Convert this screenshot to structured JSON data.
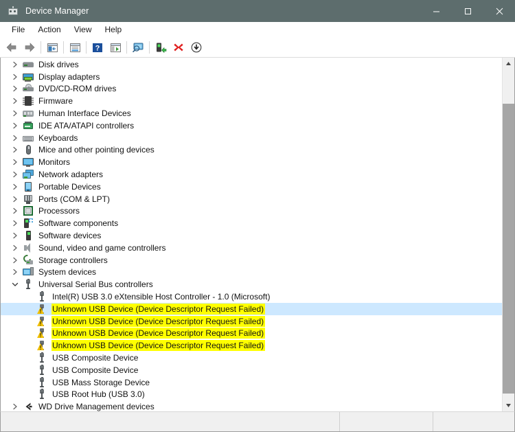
{
  "window": {
    "title": "Device Manager",
    "icon": "device-manager-icon",
    "controls": {
      "minimize": "minimize-icon",
      "maximize": "maximize-icon",
      "close": "close-icon"
    },
    "titlebar_color": "#5d6d6d"
  },
  "menu": {
    "items": [
      {
        "label": "File"
      },
      {
        "label": "Action"
      },
      {
        "label": "View"
      },
      {
        "label": "Help"
      }
    ]
  },
  "toolbar": {
    "buttons": [
      {
        "name": "back-icon",
        "tip": "Back"
      },
      {
        "name": "forward-icon",
        "tip": "Forward"
      },
      {
        "name": "separator-1",
        "tip": ""
      },
      {
        "name": "show-hide-console-tree-icon",
        "tip": "Show/Hide Console Tree"
      },
      {
        "name": "separator-2",
        "tip": ""
      },
      {
        "name": "properties-icon",
        "tip": "Properties"
      },
      {
        "name": "separator-3",
        "tip": ""
      },
      {
        "name": "help-icon",
        "tip": "Help"
      },
      {
        "name": "update-driver-icon",
        "tip": "Update driver"
      },
      {
        "name": "separator-4",
        "tip": ""
      },
      {
        "name": "scan-for-hardware-changes-icon",
        "tip": "Scan for hardware changes"
      },
      {
        "name": "separator-5",
        "tip": ""
      },
      {
        "name": "enable-device-icon",
        "tip": "Enable device"
      },
      {
        "name": "uninstall-device-icon",
        "tip": "Uninstall device"
      },
      {
        "name": "disable-device-icon",
        "tip": "Disable device"
      }
    ]
  },
  "tree": {
    "rows": [
      {
        "label": "Disk drives",
        "level": 0,
        "expander": "collapsed",
        "icon": "disk-drive-icon",
        "highlight": false,
        "selected": false
      },
      {
        "label": "Display adapters",
        "level": 0,
        "expander": "collapsed",
        "icon": "display-adapter-icon",
        "highlight": false,
        "selected": false
      },
      {
        "label": "DVD/CD-ROM drives",
        "level": 0,
        "expander": "collapsed",
        "icon": "dvd-cd-rom-icon",
        "highlight": false,
        "selected": false
      },
      {
        "label": "Firmware",
        "level": 0,
        "expander": "collapsed",
        "icon": "firmware-chip-icon",
        "highlight": false,
        "selected": false
      },
      {
        "label": "Human Interface Devices",
        "level": 0,
        "expander": "collapsed",
        "icon": "human-interface-device-icon",
        "highlight": false,
        "selected": false
      },
      {
        "label": "IDE ATA/ATAPI controllers",
        "level": 0,
        "expander": "collapsed",
        "icon": "ide-controller-icon",
        "highlight": false,
        "selected": false
      },
      {
        "label": "Keyboards",
        "level": 0,
        "expander": "collapsed",
        "icon": "keyboard-icon",
        "highlight": false,
        "selected": false
      },
      {
        "label": "Mice and other pointing devices",
        "level": 0,
        "expander": "collapsed",
        "icon": "mouse-icon",
        "highlight": false,
        "selected": false
      },
      {
        "label": "Monitors",
        "level": 0,
        "expander": "collapsed",
        "icon": "monitor-icon",
        "highlight": false,
        "selected": false
      },
      {
        "label": "Network adapters",
        "level": 0,
        "expander": "collapsed",
        "icon": "network-adapter-icon",
        "highlight": false,
        "selected": false
      },
      {
        "label": "Portable Devices",
        "level": 0,
        "expander": "collapsed",
        "icon": "portable-device-icon",
        "highlight": false,
        "selected": false
      },
      {
        "label": "Ports (COM & LPT)",
        "level": 0,
        "expander": "collapsed",
        "icon": "port-icon",
        "highlight": false,
        "selected": false
      },
      {
        "label": "Processors",
        "level": 0,
        "expander": "collapsed",
        "icon": "processor-icon",
        "highlight": false,
        "selected": false
      },
      {
        "label": "Software components",
        "level": 0,
        "expander": "collapsed",
        "icon": "software-component-icon",
        "highlight": false,
        "selected": false
      },
      {
        "label": "Software devices",
        "level": 0,
        "expander": "collapsed",
        "icon": "software-device-icon",
        "highlight": false,
        "selected": false
      },
      {
        "label": "Sound, video and game controllers",
        "level": 0,
        "expander": "collapsed",
        "icon": "sound-controller-icon",
        "highlight": false,
        "selected": false
      },
      {
        "label": "Storage controllers",
        "level": 0,
        "expander": "collapsed",
        "icon": "storage-controller-icon",
        "highlight": false,
        "selected": false
      },
      {
        "label": "System devices",
        "level": 0,
        "expander": "collapsed",
        "icon": "system-device-icon",
        "highlight": false,
        "selected": false
      },
      {
        "label": "Universal Serial Bus controllers",
        "level": 0,
        "expander": "expanded",
        "icon": "usb-icon",
        "highlight": false,
        "selected": false
      },
      {
        "label": "Intel(R) USB 3.0 eXtensible Host Controller - 1.0 (Microsoft)",
        "level": 1,
        "expander": "none",
        "icon": "usb-icon",
        "highlight": false,
        "selected": false
      },
      {
        "label": "Unknown USB Device (Device Descriptor Request Failed)",
        "level": 1,
        "expander": "none",
        "icon": "usb-warning-icon",
        "highlight": true,
        "selected": true
      },
      {
        "label": "Unknown USB Device (Device Descriptor Request Failed)",
        "level": 1,
        "expander": "none",
        "icon": "usb-warning-icon",
        "highlight": true,
        "selected": false
      },
      {
        "label": "Unknown USB Device (Device Descriptor Request Failed)",
        "level": 1,
        "expander": "none",
        "icon": "usb-warning-icon",
        "highlight": true,
        "selected": false
      },
      {
        "label": "Unknown USB Device (Device Descriptor Request Failed)",
        "level": 1,
        "expander": "none",
        "icon": "usb-warning-icon",
        "highlight": true,
        "selected": false
      },
      {
        "label": "USB Composite Device",
        "level": 1,
        "expander": "none",
        "icon": "usb-icon",
        "highlight": false,
        "selected": false
      },
      {
        "label": "USB Composite Device",
        "level": 1,
        "expander": "none",
        "icon": "usb-icon",
        "highlight": false,
        "selected": false
      },
      {
        "label": "USB Mass Storage Device",
        "level": 1,
        "expander": "none",
        "icon": "usb-icon",
        "highlight": false,
        "selected": false
      },
      {
        "label": "USB Root Hub (USB 3.0)",
        "level": 1,
        "expander": "none",
        "icon": "usb-icon",
        "highlight": false,
        "selected": false
      },
      {
        "label": "WD Drive Management devices",
        "level": 0,
        "expander": "collapsed",
        "icon": "wd-drive-icon",
        "highlight": false,
        "selected": false
      }
    ]
  },
  "scrollbar": {
    "up_arrow": "scroll-up-icon",
    "down_arrow": "scroll-down-icon",
    "thumb_top_pct": 13,
    "thumb_height_pct": 82
  },
  "statusbar": {
    "pane1": "",
    "pane2": "",
    "pane3": ""
  },
  "colors": {
    "highlight_yellow": "#ffff00",
    "selection_blue": "#cde8ff",
    "titlebar": "#5d6d6d",
    "warning": "#f2c000"
  }
}
